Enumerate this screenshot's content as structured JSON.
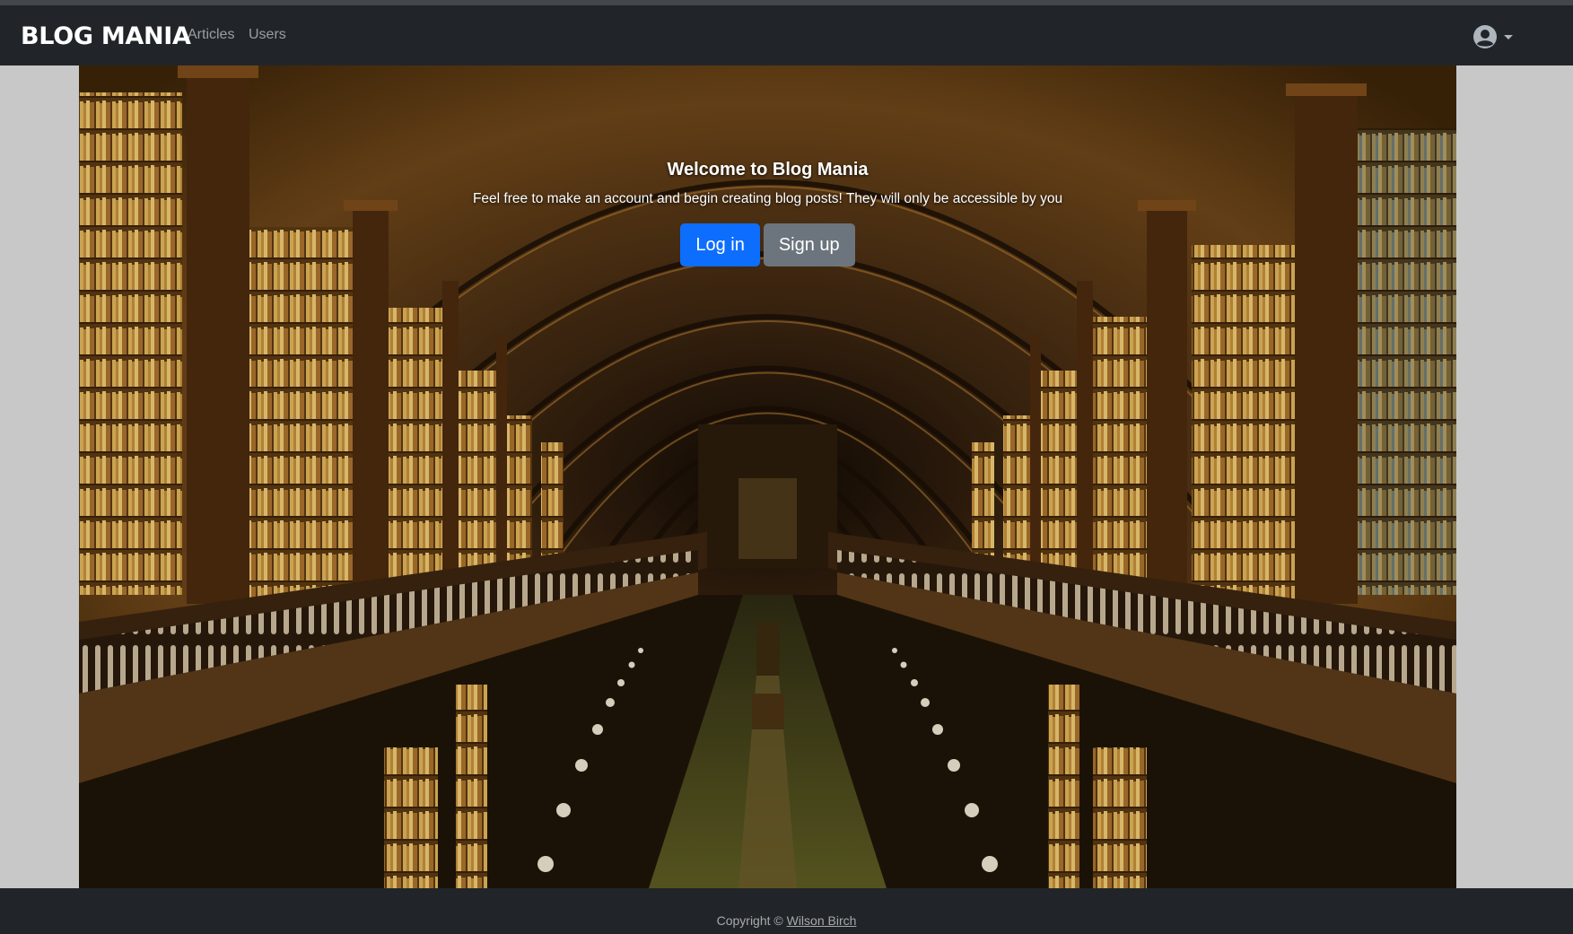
{
  "navbar": {
    "brand": "BLOG MANIA",
    "links": [
      {
        "label": "Articles"
      },
      {
        "label": "Users"
      }
    ],
    "user_menu_icon": "user-circle-icon"
  },
  "hero": {
    "title": "Welcome to Blog Mania",
    "subtitle": "Feel free to make an account and begin creating blog posts! They will only be accessible by you",
    "login_label": "Log in",
    "signup_label": "Sign up",
    "background_image": "library-interior-photo"
  },
  "footer": {
    "copyright_prefix": "Copyright ©",
    "author_link": "Wilson Birch"
  },
  "colors": {
    "navbar_bg": "#212529",
    "primary": "#0d6efd",
    "secondary": "#6c757d",
    "page_bg": "#c8c8c8"
  }
}
